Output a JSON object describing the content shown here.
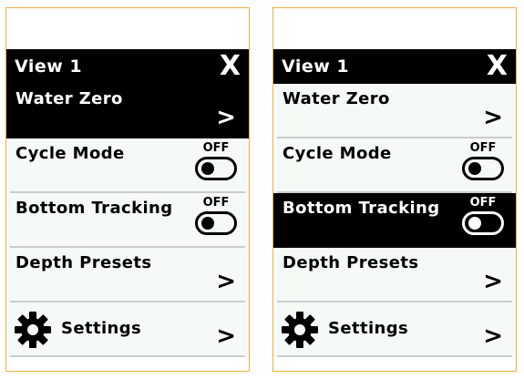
{
  "screens": [
    {
      "title": "View 1",
      "close_label": "X",
      "items": [
        {
          "label": "Water Zero",
          "control": "chevron",
          "chevron": ">"
        },
        {
          "label": "Cycle Mode",
          "control": "toggle",
          "toggle_text": "OFF"
        },
        {
          "label": "Bottom Tracking",
          "control": "toggle",
          "toggle_text": "OFF"
        },
        {
          "label": "Depth Presets",
          "control": "chevron",
          "chevron": ">"
        },
        {
          "label": "Settings",
          "control": "chevron",
          "chevron": ">",
          "icon": "gear-icon"
        }
      ],
      "selected_index": 0
    },
    {
      "title": "View 1",
      "close_label": "X",
      "items": [
        {
          "label": "Water Zero",
          "control": "chevron",
          "chevron": ">"
        },
        {
          "label": "Cycle Mode",
          "control": "toggle",
          "toggle_text": "OFF"
        },
        {
          "label": "Bottom Tracking",
          "control": "toggle",
          "toggle_text": "OFF"
        },
        {
          "label": "Depth Presets",
          "control": "chevron",
          "chevron": ">"
        },
        {
          "label": "Settings",
          "control": "chevron",
          "chevron": ">",
          "icon": "gear-icon"
        }
      ],
      "selected_index": 2
    }
  ],
  "colors": {
    "panel_border": "#f0b040",
    "header_bg": "#000000",
    "list_bg": "#f5faf7",
    "divider": "#c9cccb"
  }
}
